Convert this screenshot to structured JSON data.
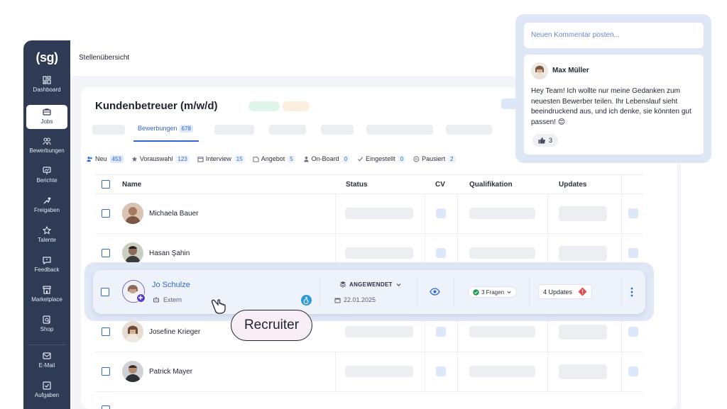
{
  "sidebar": {
    "logo": "(sg)",
    "items": [
      {
        "label": "Dashboard",
        "icon": "dashboard-icon"
      },
      {
        "label": "Jobs",
        "icon": "briefcase-icon"
      },
      {
        "label": "Bewerbungen",
        "icon": "users-icon"
      },
      {
        "label": "Berichte",
        "icon": "report-icon"
      },
      {
        "label": "Freigaben",
        "icon": "approval-icon"
      },
      {
        "label": "Talente",
        "icon": "star-icon"
      },
      {
        "label": "Feedback",
        "icon": "feedback-icon"
      },
      {
        "label": "Marketplace",
        "icon": "store-icon"
      },
      {
        "label": "Shop",
        "icon": "shop-icon"
      },
      {
        "label": "E-Mail",
        "icon": "mail-icon"
      },
      {
        "label": "Aufgaben",
        "icon": "checkbox-icon"
      }
    ]
  },
  "header": {
    "breadcrumb": "Stellenübersicht"
  },
  "job": {
    "title": "Kundenbetreuer (m/w/d)"
  },
  "tabs": {
    "active_label": "Bewerbungen",
    "active_count": "678"
  },
  "stages": [
    {
      "label": "Neu",
      "count": "453",
      "icon": "users-icon"
    },
    {
      "label": "Vorauswahl",
      "count": "123",
      "icon": "star-icon"
    },
    {
      "label": "Interview",
      "count": "15",
      "icon": "calendar-icon"
    },
    {
      "label": "Angebot",
      "count": "5",
      "icon": "offer-icon"
    },
    {
      "label": "On-Board",
      "count": "0",
      "icon": "person-icon"
    },
    {
      "label": "Eingestellt",
      "count": "0",
      "icon": "check-icon"
    },
    {
      "label": "Pausiert",
      "count": "2",
      "icon": "pause-icon"
    }
  ],
  "table": {
    "headers": {
      "name": "Name",
      "status": "Status",
      "cv": "CV",
      "qualifikation": "Qualifikation",
      "updates": "Updates"
    },
    "rows": [
      {
        "name": "Michaela Bauer"
      },
      {
        "name": "Hasan Şahin"
      },
      {
        "name": "Josefine Krieger"
      },
      {
        "name": "Patrick Mayer"
      }
    ]
  },
  "highlight": {
    "name": "Jo Schulze",
    "source": "Extern",
    "status": "ANGEWENDET",
    "date": "22.01.2025",
    "fragen": "3 Fragen",
    "updates": "4 Updates"
  },
  "recruiter_label": "Recruiter",
  "comments": {
    "placeholder": "Neuen Kommentar posten...",
    "author": "Max Müller",
    "text": "Hey Team! Ich wollte nur meine Gedanken zum neuesten Bewerber teilen. Ihr Lebenslauf sieht beeindruckend aus, und ich denke, sie könnten gut passen! 😊",
    "likes": "3"
  },
  "colors": {
    "accent": "#2d68d4",
    "sidebar": "#2f3a55",
    "danger": "#e5484d",
    "success": "#1f9d55"
  }
}
